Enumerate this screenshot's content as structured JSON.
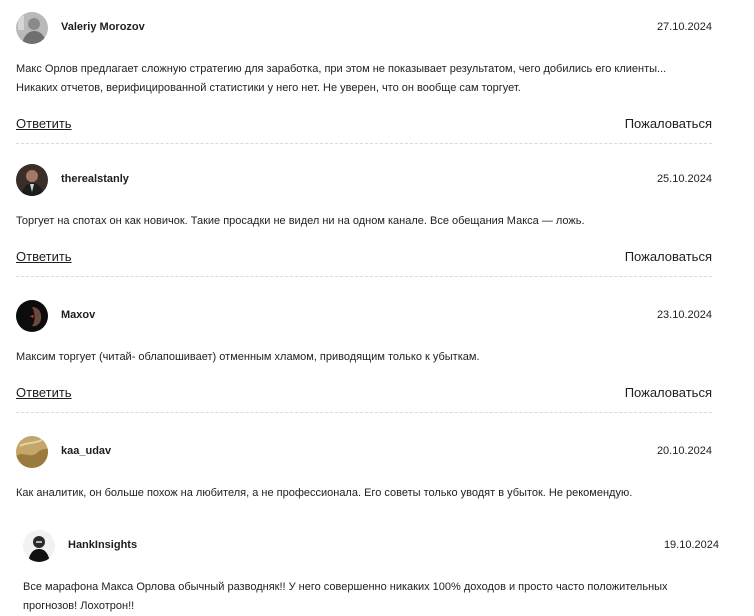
{
  "comments": [
    {
      "username": "Valeriy Morozov",
      "date": "27.10.2024",
      "text": "Макс Орлов предлагает сложную стратегию для заработка, при этом не показывает результатом, чего добились его клиенты...\nНикаких отчетов, верифицированной статистики у него нет. Не уверен, что он вообще сам торгует.",
      "reply_label": "Ответить",
      "report_label": "Пожаловаться"
    },
    {
      "username": "therealstanly",
      "date": "25.10.2024",
      "text": "Торгует на спотах он как новичок. Такие просадки не видел ни на одном канале. Все обещания Макса — ложь.",
      "reply_label": "Ответить",
      "report_label": "Пожаловаться"
    },
    {
      "username": "Maxov",
      "date": "23.10.2024",
      "text": "Максим торгует (читай- облапошивает) отменным хламом, приводящим только к убыткам.",
      "reply_label": "Ответить",
      "report_label": "Пожаловаться"
    },
    {
      "username": "kaa_udav",
      "date": "20.10.2024",
      "text": "Как аналитик, он больше похож на любителя, а не профессионала. Его советы только уводят в убыток. Не рекомендую."
    },
    {
      "username": "HankInsights",
      "date": "19.10.2024",
      "text": "Все марафона Макса Орлова обычный разводняк!! У него совершенно никаких 100% доходов и просто часто положительных\nпрогнозов! Лохотрон!!"
    }
  ]
}
